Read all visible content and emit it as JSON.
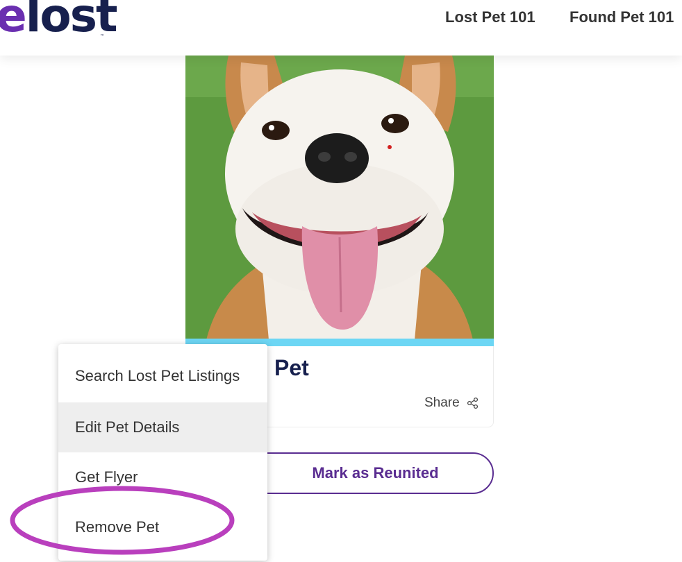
{
  "header": {
    "logo_text": "elost",
    "logo_accent_letter": "e",
    "logo_rest": "lost",
    "logo_tm": "™",
    "nav": [
      {
        "label": "Lost Pet 101"
      },
      {
        "label": "Found Pet 101"
      }
    ]
  },
  "pet_card": {
    "title": "Pet",
    "share_label": "Share",
    "share_icon": "share-icon",
    "accent_color": "#6dd6f4"
  },
  "actions": {
    "reunited_label": "Mark as Reunited"
  },
  "menu": {
    "items": [
      {
        "label": "Search Lost Pet Listings",
        "highlighted": false
      },
      {
        "label": "Edit Pet Details",
        "highlighted": true
      },
      {
        "label": "Get Flyer",
        "highlighted": false
      },
      {
        "label": "Remove Pet",
        "highlighted": false
      }
    ]
  },
  "colors": {
    "brand_navy": "#17204e",
    "brand_purple": "#5a2d91",
    "annotation_magenta": "#b93fbd"
  }
}
